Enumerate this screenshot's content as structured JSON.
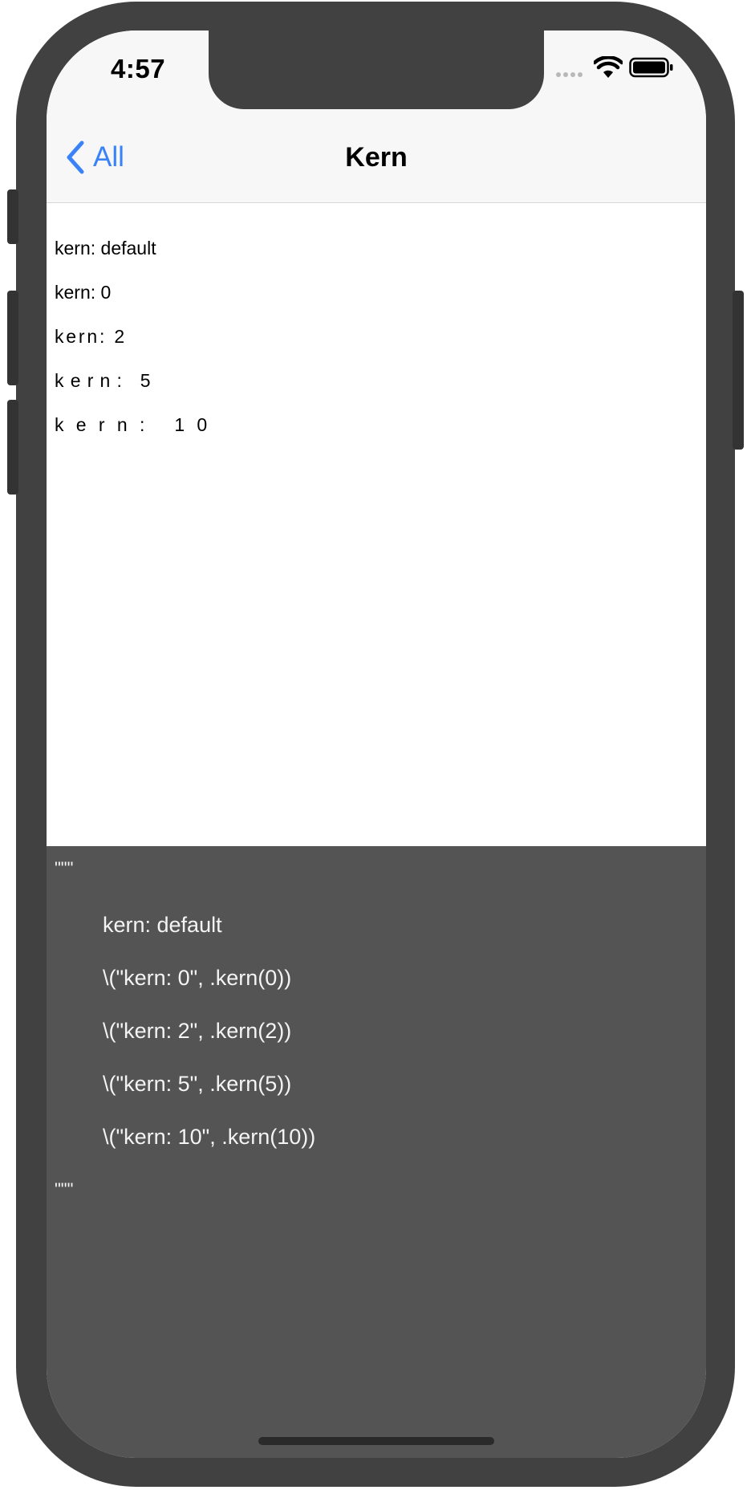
{
  "status_bar": {
    "time": "4:57"
  },
  "nav": {
    "back_label": "All",
    "title": "Kern"
  },
  "kern_samples": [
    {
      "text": "kern: default",
      "kern": 0
    },
    {
      "text": "kern: 0",
      "kern": 0
    },
    {
      "text": "kern: 2",
      "kern": 2
    },
    {
      "text": "kern: 5",
      "kern": 5
    },
    {
      "text": "kern: 10",
      "kern": 10
    }
  ],
  "code": {
    "open_quotes": "\"\"\"",
    "lines": [
      "kern: default",
      "\\(\"kern: 0\", .kern(0))",
      "\\(\"kern: 2\", .kern(2))",
      "\\(\"kern: 5\", .kern(5))",
      "\\(\"kern: 10\", .kern(10))"
    ],
    "close_quotes": "\"\"\""
  },
  "colors": {
    "accent": "#3a82f7",
    "device": "#414141",
    "code_background": "#545454"
  },
  "icons": [
    "chevron-left-icon",
    "cellular-signal-icon",
    "wifi-icon",
    "battery-icon"
  ]
}
